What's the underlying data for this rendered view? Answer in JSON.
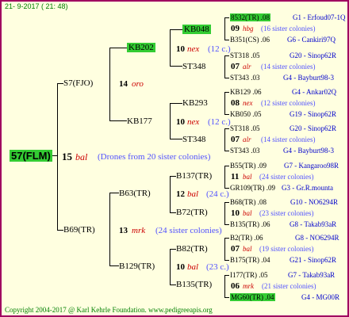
{
  "header": {
    "date": "21-  9-2017  ( 21: 48)"
  },
  "footer": {
    "copyright": "Copyright 2004-2017 @ Karl Kehrle Foundation.   www.pedigreeapis.org"
  },
  "root": {
    "name": "57(FLM)",
    "num": "15",
    "place": "bal",
    "note": "(Drones from 20 sister colonies)"
  },
  "g2": [
    {
      "name": "S7(FJO)",
      "num": "14",
      "place": "oro"
    },
    {
      "name": "B69(TR)",
      "num": "13",
      "place": "mrk",
      "note": "(24 sister colonies)"
    }
  ],
  "g3": [
    {
      "name": "KB202",
      "num": "10",
      "place": "nex",
      "note": "(12 c.)"
    },
    {
      "name": "KB177",
      "num": "10",
      "place": "nex",
      "note": "(12 c.)"
    },
    {
      "name": "B63(TR)",
      "num": "12",
      "place": "bal",
      "note": "(24 c.)"
    },
    {
      "name": "B129(TR)",
      "num": "10",
      "place": "bal",
      "note": "(23 c.)"
    }
  ],
  "g4": [
    "KB048",
    "ST348",
    "KB293",
    "ST348",
    "B137(TR)",
    "B72(TR)",
    "B82(TR)",
    "B135(TR)"
  ],
  "g5": [
    {
      "top": "8532(TR) .08",
      "topc": "G1 - Erfoud07-1Q",
      "num": "09",
      "place": "hbg",
      "note": "(16 sister colonies)",
      "bot": "B351(CS) .06",
      "botc": "G6 - Cankiri97Q"
    },
    {
      "top": "ST318 .05",
      "topc": "G20 - Sinop62R",
      "num": "07",
      "place": "alr",
      "note": "(14 sister colonies)",
      "bot": "ST343 .03",
      "botc": "G4 - Bayburt98-3"
    },
    {
      "top": "KB129 .06",
      "topc": "G4 - Ankar02Q",
      "num": "08",
      "place": "nex",
      "note": "(12 sister colonies)",
      "bot": "KB050 .05",
      "botc": "G19 - Sinop62R"
    },
    {
      "top": "ST318 .05",
      "topc": "G20 - Sinop62R",
      "num": "07",
      "place": "alr",
      "note": "(14 sister colonies)",
      "bot": "ST343 .03",
      "botc": "G4 - Bayburt98-3"
    },
    {
      "top": "B55(TR) .09",
      "topc": "G7 - Kangaroo98R",
      "num": "11",
      "place": "bal",
      "note": "(24 sister colonies)",
      "bot": "GR109(TR) .09",
      "botc": "G3 - Gr.R.mounta"
    },
    {
      "top": "B68(TR) .08",
      "topc": "G10 - NO6294R",
      "num": "10",
      "place": "bal",
      "note": "(23 sister colonies)",
      "bot": "B135(TR) .06",
      "botc": "G8 - Takab93aR"
    },
    {
      "top": "B2(TR) .06",
      "topc": "G8 - NO6294R",
      "num": "07",
      "place": "bal",
      "note": "(19 sister colonies)",
      "bot": "B175(TR) .04",
      "botc": "G21 - Sinop62R"
    },
    {
      "top": "I177(TR) .05",
      "topc": "G7 - Takab93aR",
      "num": "06",
      "place": "mrk",
      "note": "(21 sister colonies)",
      "bot": "MG60(TR) .04",
      "botc": "G4 - MG00R"
    }
  ]
}
